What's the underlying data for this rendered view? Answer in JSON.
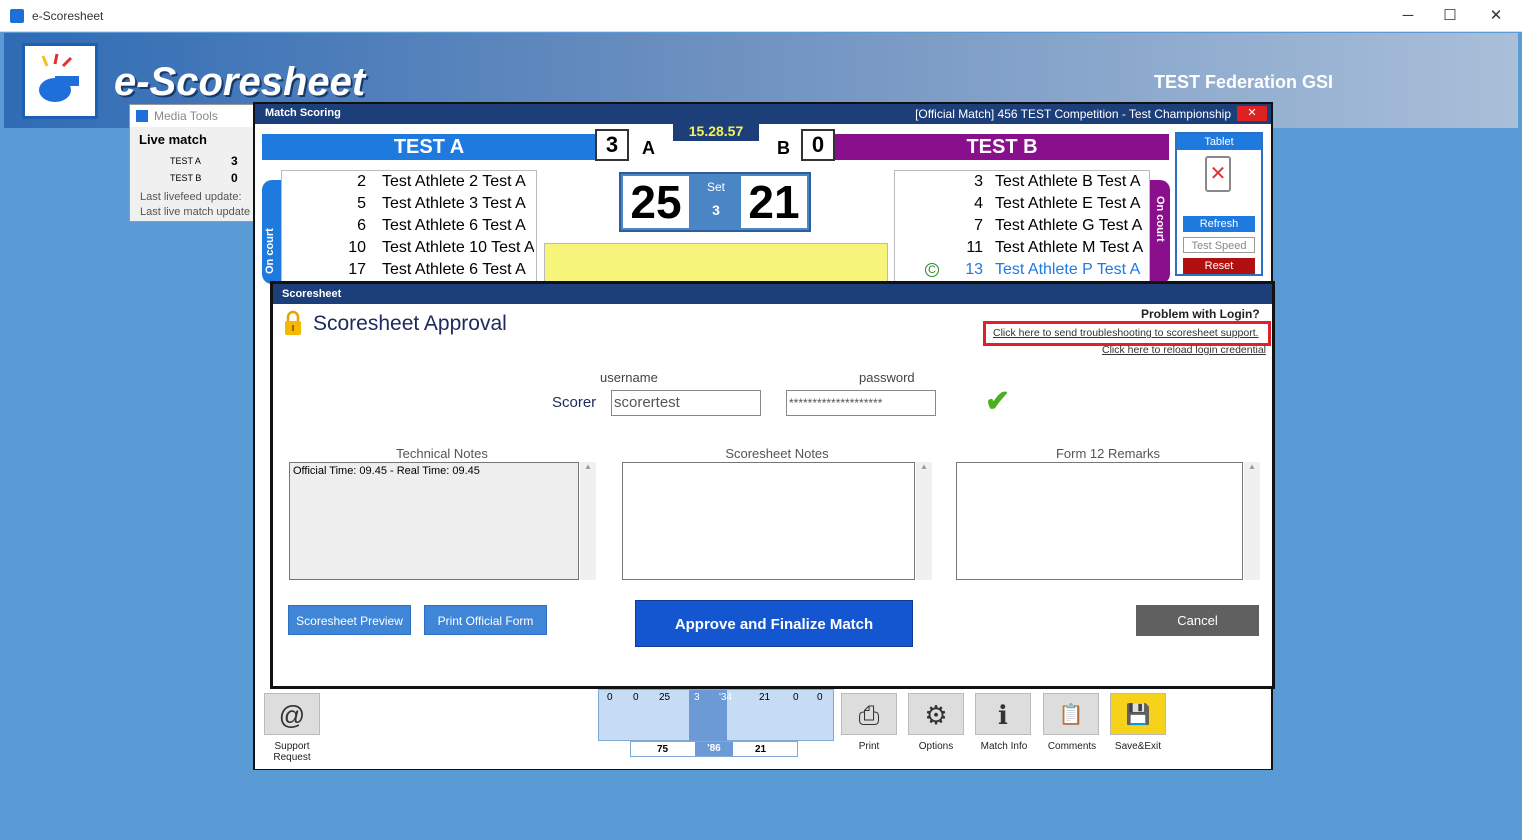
{
  "window": {
    "title": "e-Scoresheet",
    "min": "─",
    "max": "☐",
    "close": "✕"
  },
  "banner": {
    "logo_text": "e-Scoresheet",
    "federation": "TEST Federation GSI"
  },
  "media_tools": {
    "title": "Media Tools",
    "live_match": "Live match",
    "team_a": "TEST A",
    "team_a_score": "3",
    "team_b": "TEST B",
    "team_b_score": "0",
    "livefeed": "Last livefeed update:",
    "livematch": "Last live match update"
  },
  "match": {
    "title": "Match Scoring",
    "info": "[Official Match]  456  TEST Competition - Test Championship",
    "close": "✕",
    "team_a": "TEST A",
    "team_b": "TEST B",
    "sets_a": "3",
    "sets_b": "0",
    "side_a": "A",
    "side_b": "B",
    "clock": "15.28.57",
    "score_a": "25",
    "score_b": "21",
    "set_label": "Set",
    "set_num": "3",
    "on_court": "On court",
    "roster_a": [
      {
        "num": "2",
        "name": "Test Athlete 2 Test A"
      },
      {
        "num": "5",
        "name": "Test Athlete 3 Test A"
      },
      {
        "num": "6",
        "name": "Test Athlete 6 Test A"
      },
      {
        "num": "10",
        "name": "Test Athlete 10 Test A"
      },
      {
        "num": "17",
        "name": "Test Athlete 6 Test A"
      }
    ],
    "roster_b": [
      {
        "num": "3",
        "name": "Test Athlete B Test A"
      },
      {
        "num": "4",
        "name": "Test Athlete E Test A"
      },
      {
        "num": "7",
        "name": "Test Athlete G Test A"
      },
      {
        "num": "11",
        "name": "Test Athlete M Test A"
      },
      {
        "num": "13",
        "name": "Test Athlete P Test A"
      }
    ],
    "captain_badge": "C",
    "tablet": {
      "title": "Tablet",
      "refresh": "Refresh",
      "test_speed": "Test Speed",
      "reset": "Reset"
    }
  },
  "bottom": {
    "support_icon": "@",
    "support_label": "Support Request",
    "setlog_top": [
      "0",
      "0",
      "25",
      "3",
      "'34",
      "21",
      "0",
      "0"
    ],
    "setlog_bottom": [
      "75",
      "'86",
      "21"
    ],
    "tools": [
      {
        "label": "Print",
        "icon": "printer-icon",
        "glyph": "⎙"
      },
      {
        "label": "Options",
        "icon": "gear-icon",
        "glyph": "⚙"
      },
      {
        "label": "Match Info",
        "icon": "info-icon",
        "glyph": "ℹ"
      },
      {
        "label": "Comments",
        "icon": "clipboard-icon",
        "glyph": "📋"
      },
      {
        "label": "Save&Exit",
        "icon": "save-icon",
        "glyph": "💾"
      }
    ]
  },
  "dialog": {
    "title": "Scoresheet",
    "heading": "Scoresheet Approval",
    "problem": "Problem with Login?",
    "support_link": "Click here to send troubleshooting to scoresheet support.",
    "reload_link": "Click here to reload login credential",
    "username_label": "username",
    "password_label": "password",
    "scorer_label": "Scorer",
    "username_value": "scorertest",
    "password_value": "********************",
    "tech_notes_label": "Technical Notes",
    "tech_notes_value": "Official Time:  09.45  -  Real Time:  09.45",
    "scoresheet_notes_label": "Scoresheet Notes",
    "form12_label": "Form 12 Remarks",
    "preview_btn": "Scoresheet Preview",
    "print_btn": "Print Official Form",
    "approve_btn": "Approve and Finalize Match",
    "cancel_btn": "Cancel"
  },
  "colors": {
    "accent": "#1356d0",
    "team_a": "#1f7ae0",
    "team_b": "#8a0f8c",
    "highlight": "#e0202a"
  }
}
